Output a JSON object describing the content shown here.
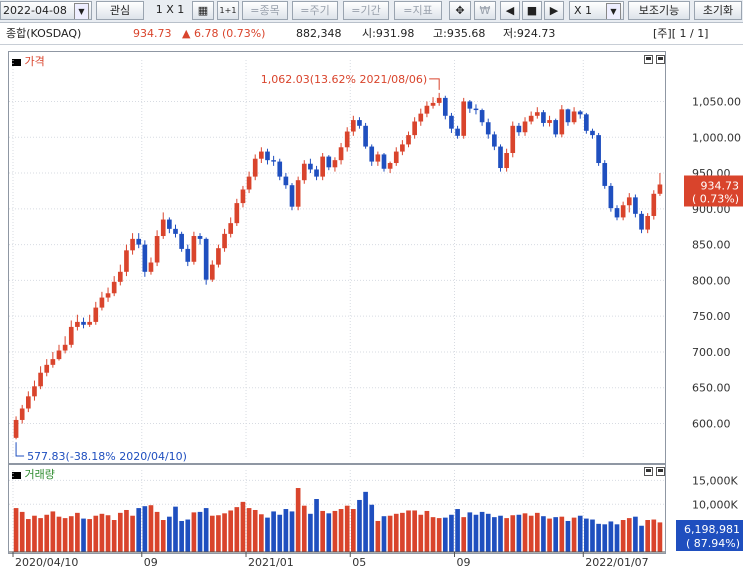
{
  "toolbar": {
    "date": "2022-04-08",
    "watchlist": "관심",
    "layout": "1 X 1",
    "btn_1x1": "1+1",
    "item": "=종목",
    "period": "=주기",
    "range": "=기간",
    "indicator": "=지표",
    "cross_icon": "crosshair-icon",
    "won_icon": "won-icon",
    "zoom": "X 1",
    "aux": "보조기능",
    "reset": "초기화"
  },
  "infobar": {
    "name": "종합(KOSDAQ)",
    "price": "934.73",
    "change": "▲ 6.78 (0.73%)",
    "volume": "882,348",
    "open": "시:931.98",
    "high": "고:935.68",
    "low": "저:924.73",
    "unit": "[주][ 1 / 1]"
  },
  "price_panel": {
    "label": "가격",
    "max_note": "1,062.03(13.62% 2021/08/06)",
    "min_note": "577.83(-38.18% 2020/04/10)",
    "current_line1": "934.73",
    "current_line2": "( 0.73%)"
  },
  "volume_panel": {
    "label": "거래량",
    "current_line1": "6,198,981",
    "current_line2": "( 87.94%)"
  },
  "colors": {
    "up": "#d9442c",
    "down": "#1f4fbf",
    "volume_label": "#2e8b2e",
    "price_label": "#d9442c"
  },
  "chart_data": {
    "type": "candlestick",
    "period": "weekly",
    "x_tick_labels": [
      "2020/04/10",
      "09",
      "2021/01",
      "05",
      "09",
      "2022/01/07"
    ],
    "price": {
      "ylim": [
        570,
        1080
      ],
      "y_tick_labels": [
        "1,050.00",
        "1,000.00",
        "950.00",
        "900.00",
        "850.00",
        "800.00",
        "750.00",
        "700.00",
        "650.00",
        "600.00"
      ],
      "y_tick_values": [
        1050,
        1000,
        950,
        900,
        850,
        800,
        750,
        700,
        650,
        600
      ],
      "close": [
        605,
        621,
        638,
        652,
        671,
        682,
        690,
        702,
        710,
        735,
        742,
        738,
        742,
        762,
        776,
        782,
        798,
        812,
        842,
        858,
        850,
        812,
        825,
        862,
        885,
        872,
        865,
        844,
        826,
        862,
        858,
        801,
        822,
        845,
        865,
        880,
        908,
        927,
        945,
        970,
        980,
        968,
        966,
        945,
        933,
        903,
        940,
        963,
        955,
        945,
        973,
        958,
        968,
        986,
        1008,
        1024,
        1016,
        987,
        966,
        976,
        956,
        964,
        980,
        990,
        1003,
        1022,
        1033,
        1044,
        1048,
        1055,
        1030,
        1012,
        1002,
        1050,
        1040,
        1038,
        1021,
        1004,
        987,
        957,
        978,
        1016,
        1007,
        1022,
        1030,
        1035,
        1020,
        1024,
        1004,
        1039,
        1021,
        1036,
        1032,
        1009,
        1003,
        964,
        932,
        901,
        888,
        905,
        916,
        893,
        871,
        890,
        921,
        934
      ],
      "open": [
        580,
        605,
        621,
        638,
        652,
        671,
        682,
        690,
        702,
        710,
        735,
        742,
        738,
        742,
        762,
        776,
        782,
        798,
        812,
        842,
        858,
        850,
        812,
        825,
        862,
        885,
        872,
        865,
        844,
        826,
        862,
        858,
        801,
        822,
        845,
        865,
        880,
        908,
        927,
        945,
        970,
        980,
        968,
        966,
        945,
        933,
        903,
        940,
        963,
        955,
        945,
        973,
        958,
        968,
        986,
        1008,
        1024,
        1016,
        987,
        966,
        976,
        956,
        964,
        980,
        990,
        1003,
        1022,
        1033,
        1044,
        1048,
        1055,
        1030,
        1012,
        1002,
        1050,
        1040,
        1038,
        1021,
        1004,
        987,
        957,
        978,
        1016,
        1007,
        1022,
        1030,
        1035,
        1020,
        1024,
        1004,
        1039,
        1021,
        1036,
        1032,
        1009,
        1003,
        964,
        932,
        901,
        888,
        905,
        916,
        893,
        871,
        890,
        921
      ],
      "high": [
        610,
        626,
        645,
        660,
        680,
        690,
        700,
        710,
        722,
        744,
        752,
        748,
        752,
        770,
        784,
        790,
        806,
        822,
        850,
        866,
        866,
        856,
        832,
        870,
        895,
        888,
        878,
        868,
        850,
        868,
        866,
        860,
        828,
        850,
        872,
        888,
        914,
        932,
        952,
        976,
        986,
        984,
        974,
        970,
        950,
        936,
        945,
        968,
        970,
        960,
        978,
        975,
        972,
        992,
        1014,
        1030,
        1028,
        1020,
        990,
        980,
        978,
        966,
        986,
        996,
        1008,
        1028,
        1040,
        1050,
        1056,
        1062,
        1058,
        1034,
        1016,
        1055,
        1052,
        1046,
        1040,
        1026,
        1008,
        990,
        984,
        1022,
        1020,
        1028,
        1036,
        1042,
        1038,
        1030,
        1026,
        1045,
        1040,
        1042,
        1038,
        1034,
        1012,
        1006,
        968,
        936,
        905,
        910,
        922,
        920,
        897,
        894,
        926,
        950
      ],
      "low": [
        578,
        600,
        616,
        632,
        648,
        666,
        678,
        688,
        698,
        706,
        730,
        733,
        735,
        738,
        758,
        770,
        778,
        793,
        806,
        836,
        845,
        805,
        808,
        820,
        858,
        866,
        860,
        840,
        820,
        822,
        850,
        794,
        798,
        818,
        840,
        860,
        876,
        902,
        922,
        940,
        964,
        962,
        960,
        940,
        928,
        898,
        898,
        935,
        950,
        940,
        940,
        954,
        952,
        962,
        980,
        1002,
        1012,
        984,
        960,
        960,
        952,
        950,
        960,
        975,
        986,
        998,
        1016,
        1028,
        1040,
        1044,
        1025,
        1006,
        998,
        998,
        1034,
        1032,
        1016,
        998,
        982,
        952,
        952,
        972,
        1002,
        1002,
        1018,
        1026,
        1015,
        1015,
        1000,
        1000,
        1016,
        1018,
        1026,
        1005,
        998,
        960,
        928,
        896,
        884,
        884,
        895,
        888,
        866,
        866,
        885,
        918
      ]
    },
    "volume": {
      "y_tick_labels": [
        "15,000K",
        "10,000K"
      ],
      "y_tick_values": [
        15000,
        10000
      ],
      "unit": "K",
      "values_k": [
        9200,
        8400,
        6900,
        7600,
        7100,
        7800,
        8500,
        7400,
        7100,
        7500,
        8200,
        7000,
        6900,
        7600,
        8000,
        7700,
        6700,
        8200,
        8800,
        7600,
        9200,
        9600,
        9800,
        8400,
        6700,
        7400,
        9500,
        6500,
        6800,
        8300,
        8400,
        9200,
        7600,
        7700,
        8100,
        8700,
        9400,
        10500,
        9200,
        8800,
        7900,
        7200,
        8500,
        7800,
        9000,
        8500,
        13400,
        9700,
        8000,
        11100,
        8600,
        8100,
        8600,
        9000,
        9700,
        9000,
        10900,
        12600,
        9900,
        6500,
        7500,
        7600,
        8000,
        8200,
        8700,
        8700,
        7800,
        8600,
        7300,
        7100,
        7200,
        7800,
        9000,
        7300,
        8300,
        7800,
        8400,
        8000,
        7300,
        7600,
        7100,
        7700,
        7800,
        8100,
        7600,
        8200,
        7500,
        7000,
        7300,
        7400,
        6500,
        7200,
        7600,
        7000,
        6800,
        5900,
        5800,
        6400,
        5800,
        6700,
        7100,
        7400,
        5500,
        6700,
        6800,
        6200
      ]
    },
    "annotations": [
      {
        "text": "1,062.03(13.62% 2021/08/06)",
        "type": "max"
      },
      {
        "text": "577.83(-38.18% 2020/04/10)",
        "type": "min"
      }
    ]
  }
}
